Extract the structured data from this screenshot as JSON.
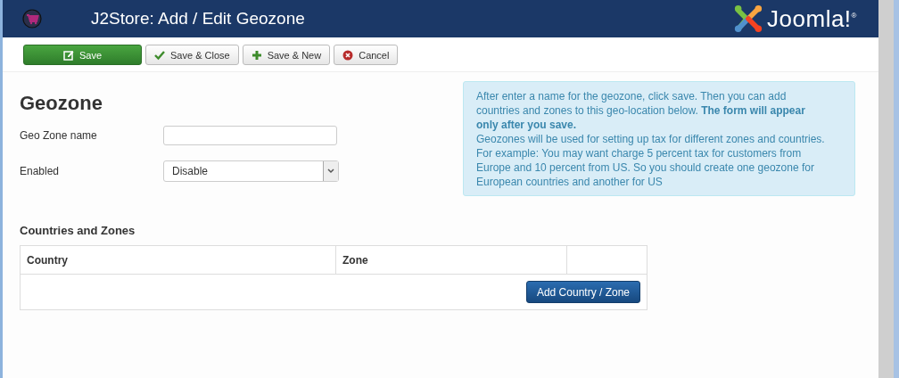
{
  "header": {
    "title": "J2Store: Add / Edit Geozone",
    "logo_text": "Joomla!$^{®}$"
  },
  "toolbar": [
    {
      "label": "Save",
      "kind": "save"
    },
    {
      "label": "Save & Close",
      "kind": "close"
    },
    {
      "label": "Save & New",
      "kind": "new"
    },
    {
      "label": "Cancel",
      "kind": "cancel"
    }
  ],
  "form": {
    "heading": "Geozone",
    "fields": [
      {
        "label": "Geo Zone name",
        "kind": "text"
      },
      {
        "label": "Enabled",
        "kind": "select",
        "value": "Disable"
      }
    ]
  },
  "info": {
    "paragraphs": [
      "After enter a name for the geozone, click save. Then you can add countries and zones to this geo-location below. **The form will appear only after you save.**",
      "Geozones will be used for setting up tax for different zones and countries. For example: You may want charge 5 percent tax for customers from Europe and 10 percent from US. So you should create one geozone for European countries and another for US"
    ]
  },
  "zones": {
    "heading": "Countries and Zones",
    "columns": [
      "Country",
      "Zone"
    ],
    "add_button": "Add Country / Zone"
  }
}
